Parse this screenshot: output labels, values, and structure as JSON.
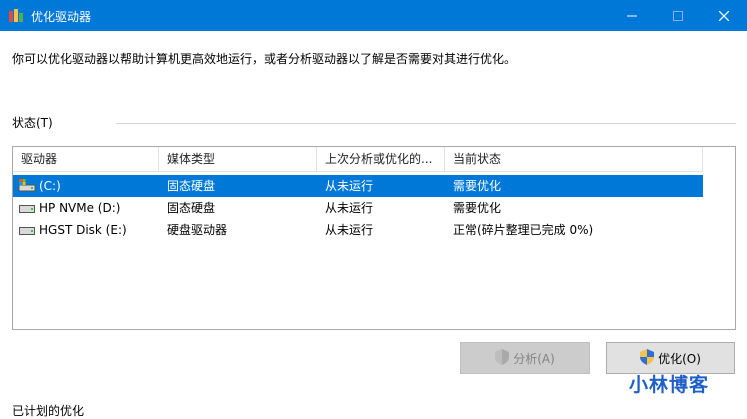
{
  "window": {
    "title": "优化驱动器",
    "accent": "#0078d7"
  },
  "description": "你可以优化驱动器以帮助计算机更高效地运行，或者分析驱动器以了解是否需要对其进行优化。",
  "status_section": {
    "label": "状态(T)",
    "columns": [
      "驱动器",
      "媒体类型",
      "上次分析或优化的...",
      "当前状态"
    ],
    "rows": [
      {
        "icon": "system-drive-icon",
        "drive": "(C:)",
        "media": "固态硬盘",
        "last_run": "从未运行",
        "status": "需要优化",
        "selected": true
      },
      {
        "icon": "drive-icon",
        "drive": "HP NVMe (D:)",
        "media": "固态硬盘",
        "last_run": "从未运行",
        "status": "需要优化",
        "selected": false
      },
      {
        "icon": "drive-icon",
        "drive": "HGST Disk (E:)",
        "media": "硬盘驱动器",
        "last_run": "从未运行",
        "status": "正常(碎片整理已完成 0%)",
        "selected": false
      }
    ]
  },
  "buttons": {
    "analyze": "分析(A)",
    "optimize": "优化(O)"
  },
  "scheduled_section": {
    "label": "已计划的优化"
  },
  "watermark": "小林博客"
}
